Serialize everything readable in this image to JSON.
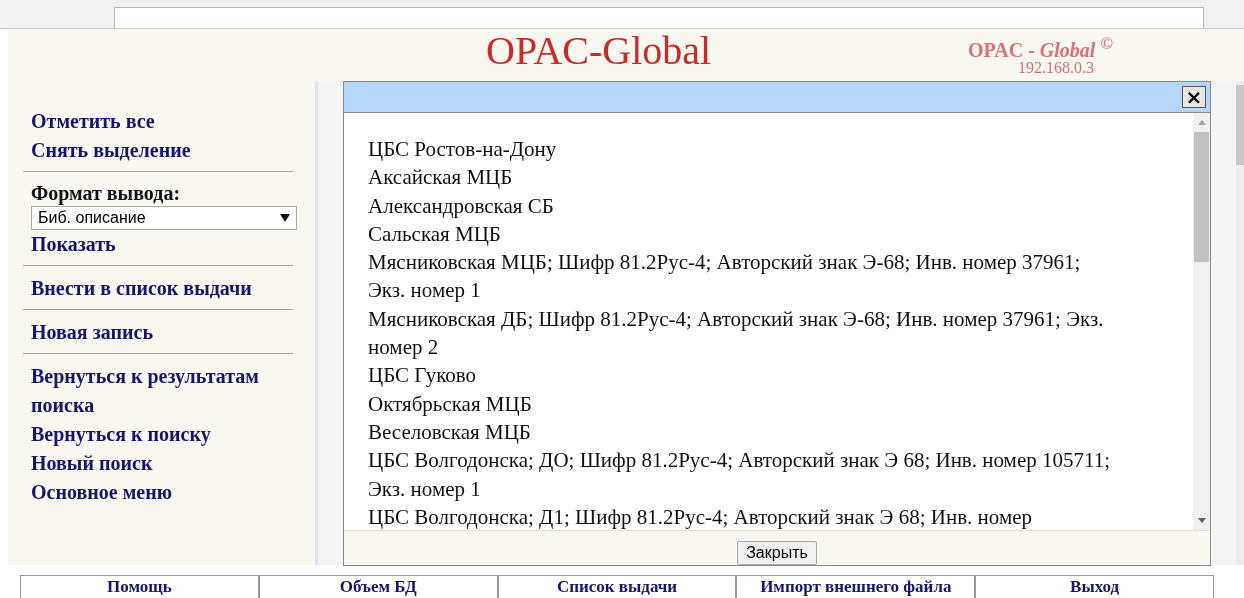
{
  "header": {
    "logo": "OPAC-Global",
    "product": "OPAC - *Global* $^{©}$",
    "address": "192.168.0.3"
  },
  "sidebar": {
    "groups": [
      [
        {
          "kind": "link",
          "label": "Отметить все"
        },
        {
          "kind": "link",
          "label": "Снять выделение"
        }
      ],
      [
        {
          "kind": "heading",
          "label": "Формат вывода:"
        },
        {
          "kind": "select",
          "value": "Биб. описание"
        },
        {
          "kind": "link",
          "label": "Показать"
        }
      ],
      [
        {
          "kind": "link",
          "label": "Внести в список выдачи"
        }
      ],
      [
        {
          "kind": "link",
          "label": "Новая запись"
        }
      ],
      [
        {
          "kind": "link",
          "label": "Вернуться к результатам поиска"
        },
        {
          "kind": "link",
          "label": "Вернуться к поиску"
        },
        {
          "kind": "link",
          "label": "Новый поиск"
        },
        {
          "kind": "link",
          "label": "Основное меню"
        }
      ]
    ]
  },
  "dialog": {
    "close_icon": "×",
    "lines": [
      "ЦБС Ростов-на-Дону",
      "Аксайская МЦБ",
      "Александровская СБ",
      "Сальская МЦБ",
      "Мясниковская МЦБ; Шифр 81.2Рус-4; Авторский знак Э-68; Инв. номер 37961; Экз. номер 1",
      "Мясниковская ДБ; Шифр 81.2Рус-4; Авторский знак Э-68; Инв. номер 37961; Экз. номер 2",
      "ЦБС Гуково",
      "Октябрьская МЦБ",
      "Веселовская МЦБ",
      "ЦБС Волгодонска; ДО; Шифр 81.2Рус-4; Авторский знак Э 68; Инв. номер 105711; Экз. номер 1",
      "ЦБС Волгодонска; Д1; Шифр 81.2Рус-4; Авторский знак Э 68; Инв. номер"
    ],
    "button": "Закрыть"
  },
  "footer_nav": [
    "Помощь",
    "Объем БД",
    "Список выдачи",
    "Импорт внешнего файла",
    "Выход"
  ]
}
